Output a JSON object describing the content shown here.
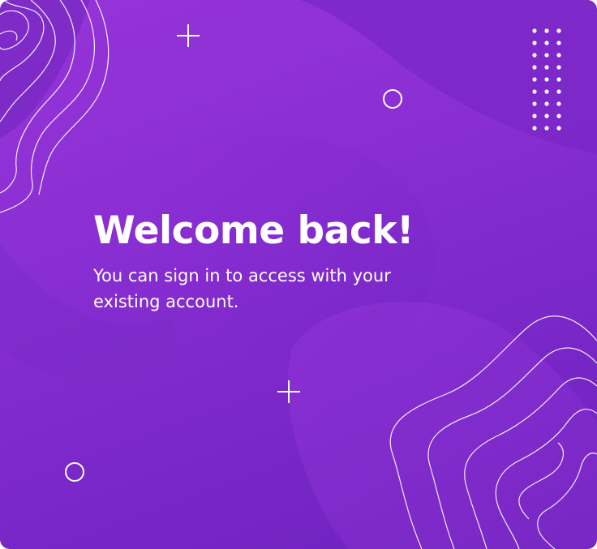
{
  "welcome": {
    "title": "Welcome back!",
    "subtitle": "You can sign in to access with your existing account."
  },
  "colors": {
    "gradient_start": "#9634d8",
    "gradient_end": "#6d22bd",
    "text": "#ffffff"
  },
  "icons": [
    "plus-icon",
    "ring-icon",
    "dot-grid",
    "contour-lines"
  ]
}
